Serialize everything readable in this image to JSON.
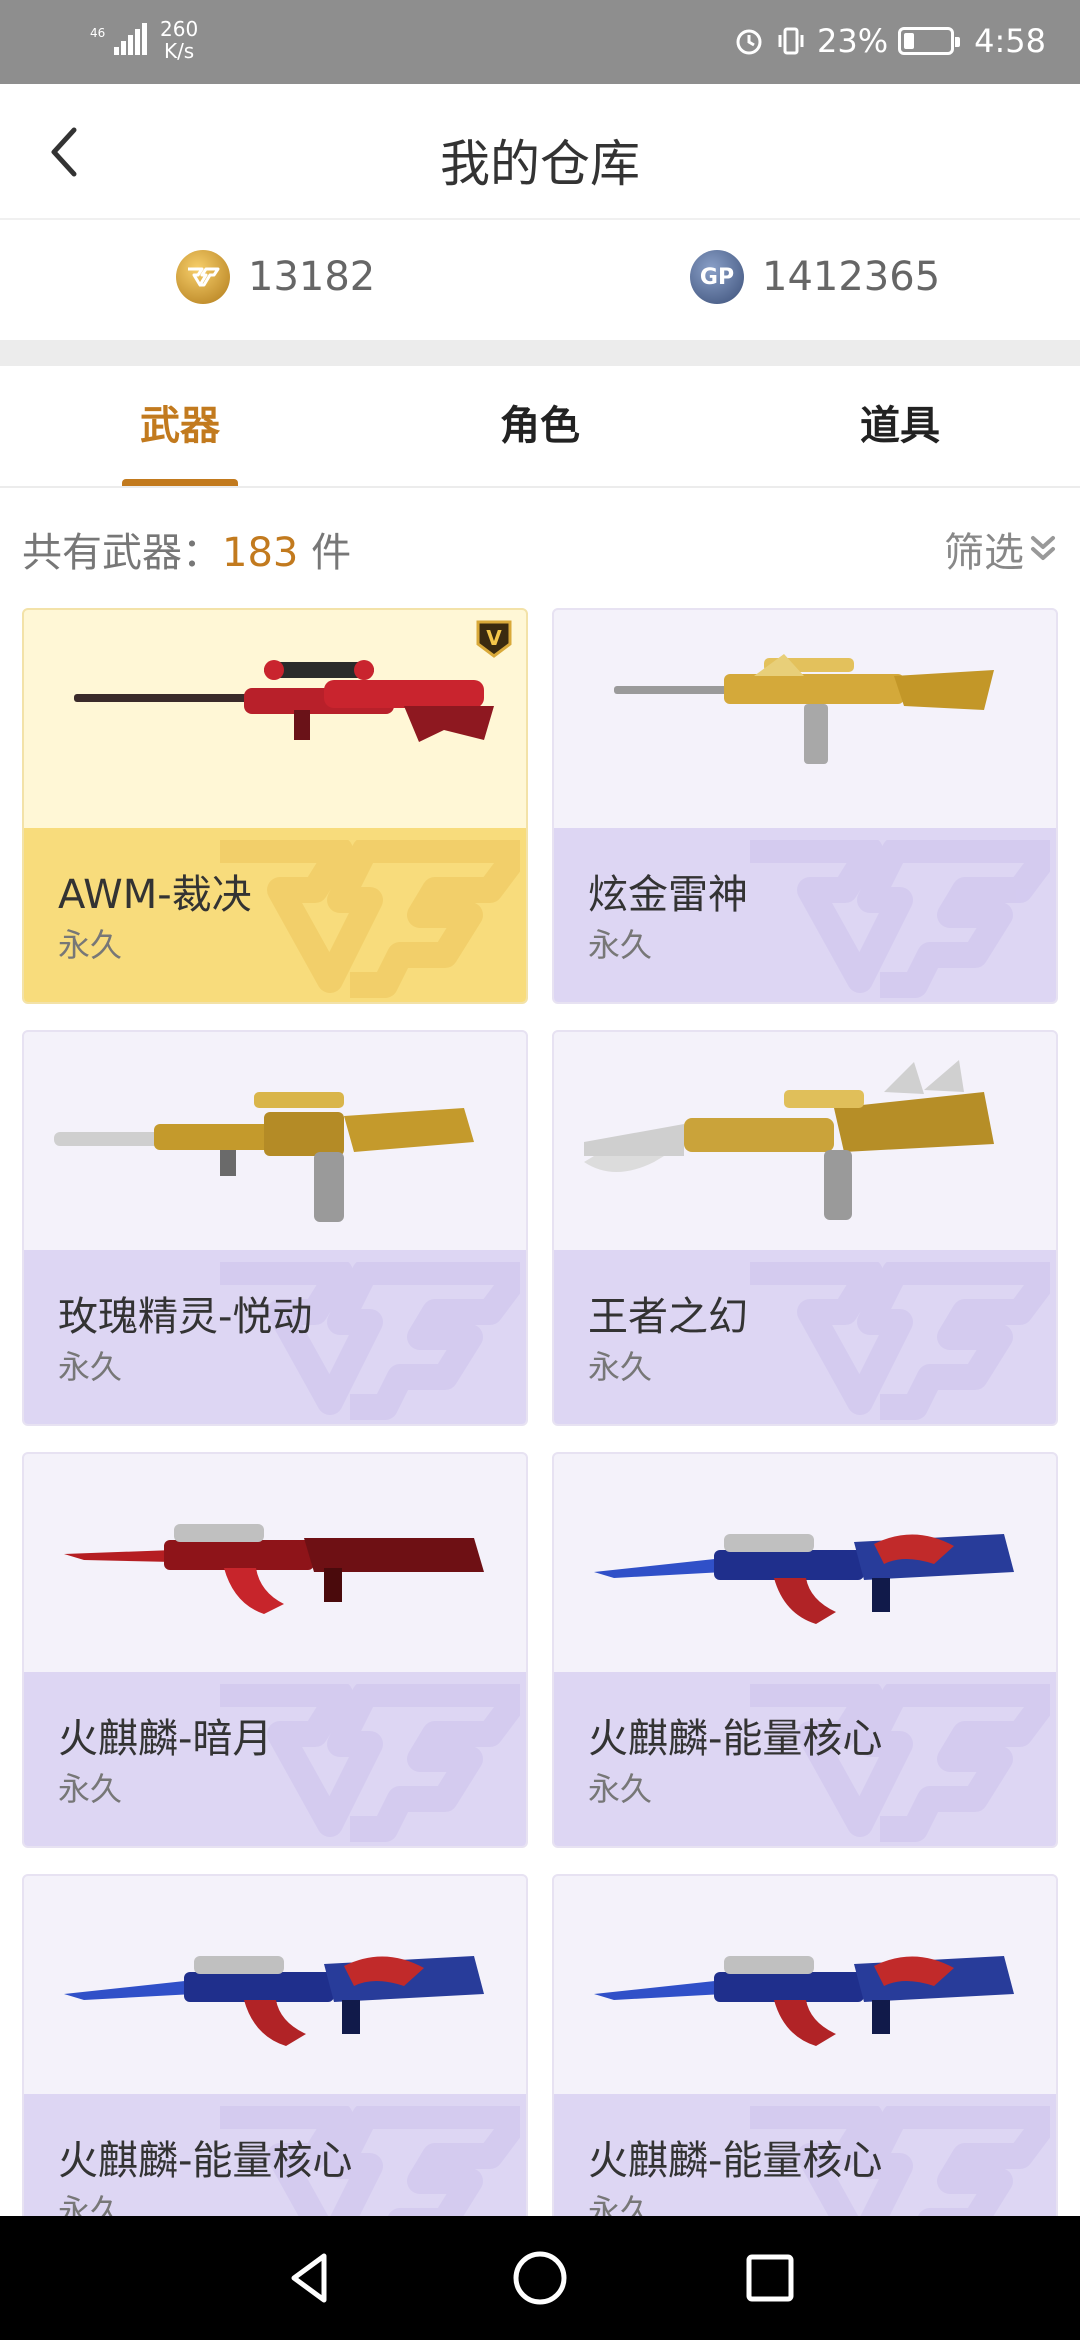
{
  "status_bar": {
    "network_type": "46",
    "speed_value": "260",
    "speed_unit": "K/s",
    "battery_percent": "23%",
    "battery_level": 0.23,
    "time": "4:58"
  },
  "header": {
    "title": "我的仓库"
  },
  "currency": {
    "cf_points": "13182",
    "gp_points": "1412365",
    "gp_symbol": "GP"
  },
  "tabs": [
    {
      "label": "武器",
      "active": true
    },
    {
      "label": "角色",
      "active": false
    },
    {
      "label": "道具",
      "active": false
    }
  ],
  "summary": {
    "count_prefix": "共有武器：",
    "count_value": "183",
    "count_suffix": " 件",
    "filter_label": "筛选"
  },
  "cards": [
    {
      "name": "AWM-裁决",
      "duration": "永久",
      "tier": "gold",
      "weapon": "sniper-red",
      "vip": "V"
    },
    {
      "name": "炫金雷神",
      "duration": "永久",
      "tier": "purple",
      "weapon": "rifle-gold"
    },
    {
      "name": "玫瑰精灵-悦动",
      "duration": "永久",
      "tier": "purple",
      "weapon": "m4-gold"
    },
    {
      "name": "王者之幻",
      "duration": "永久",
      "tier": "purple",
      "weapon": "m4-king"
    },
    {
      "name": "火麒麟-暗月",
      "duration": "永久",
      "tier": "purple",
      "weapon": "ak-red"
    },
    {
      "name": "火麒麟-能量核心",
      "duration": "永久",
      "tier": "purple",
      "weapon": "ak-blue"
    },
    {
      "name": "火麒麟-能量核心",
      "duration": "永久",
      "tier": "purple",
      "weapon": "ak-blue"
    },
    {
      "name": "火麒麟-能量核心",
      "duration": "永久",
      "tier": "purple",
      "weapon": "ak-blue"
    }
  ],
  "colors": {
    "accent": "#c27a1e",
    "gold_card": "#f8dc7c",
    "purple_card": "#ddd6f3"
  },
  "navbar": {
    "icons": [
      "back-triangle-icon",
      "home-circle-icon",
      "recents-square-icon"
    ]
  }
}
